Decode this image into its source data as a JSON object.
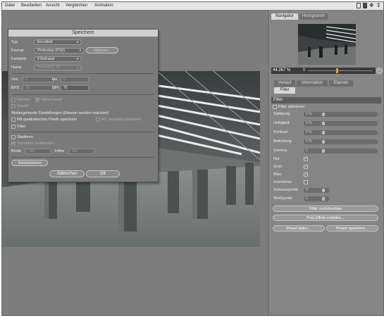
{
  "menu": {
    "items": [
      "Datei",
      "Bearbeiten",
      "Ansicht",
      "Vergleichen",
      "Animation"
    ]
  },
  "dialog": {
    "title": "Speichern",
    "typ_label": "Typ",
    "typ_value": "Einzelbild",
    "format_label": "Format",
    "format_value": "Photoshop (PSD)",
    "optionen_label": "Optionen...",
    "farbtiefe_label": "Farbtiefe",
    "farbtiefe_value": "8 Bit/Kanal",
    "name_label": "Name",
    "name_value": "Name0000.TIF",
    "von_label": "Von",
    "von_value": "0",
    "bis_label": "bis",
    "bis_value": "0",
    "bps_label": "BPS",
    "bps_value": "30",
    "dpi_label": "DPI",
    "dpi_value": "72",
    "ebenen_label": "Ebenen",
    "alpha_label": "Alpha-Kanal",
    "sound_label": "Sound",
    "weitergehende_label": "Weitergehende Einstellungen (Ebenen werden reduziert)",
    "quadratisch_label": "Mit quadratischen Pixeln speichern",
    "vergleich_label": "Als Vergleich speichern",
    "filter_label": "Filter",
    "skalieren_label": "Skalieren",
    "verhaeltnis_label": "Verhältnis beibehalten",
    "breite_label": "Breite",
    "breite_value": "320",
    "hoehe_label": "Höhe",
    "hoehe_value": "240",
    "zuruecksetzen_label": "Zurücksetzen",
    "abbrechen_label": "Abbrechen",
    "ok_label": "OK"
  },
  "right_panel": {
    "tabs_top": [
      "Navigator",
      "Histogramm"
    ],
    "zoom_value": "44.267 %",
    "tabs_mid": [
      "Verlauf",
      "Information",
      "Ebenen"
    ],
    "tab_filter": "Filter",
    "filter_header": "Filter",
    "filter_aktivieren": "Filter aktivieren",
    "rows": [
      {
        "label": "Sättigung",
        "value": "0 %"
      },
      {
        "label": "Helligkeit",
        "value": "0 %"
      },
      {
        "label": "Kontrast",
        "value": "0 %"
      },
      {
        "label": "Belichtung",
        "value": "0 %"
      },
      {
        "label": "Gamma",
        "value": "1"
      }
    ],
    "checks": [
      {
        "label": "Rot"
      },
      {
        "label": "Grün"
      },
      {
        "label": "Blau"
      },
      {
        "label": "Invertieren"
      }
    ],
    "schwarzpunkt_label": "Schwarzpunkt",
    "schwarzpunkt_value": "0",
    "weisspunkt_label": "Weißpunkt",
    "weisspunkt_value": "1",
    "btn_filter_reset": "Filter zurücksetzen",
    "btn_post_effekt": "Post Effekt erstellen...",
    "btn_preset_laden": "Preset laden...",
    "btn_preset_speichern": "Preset speichern..."
  },
  "colors": {
    "background": "#8a8a8a",
    "panel": "#858585",
    "dialog": "#7a7a7a",
    "accent_orange": "#e0a030"
  }
}
